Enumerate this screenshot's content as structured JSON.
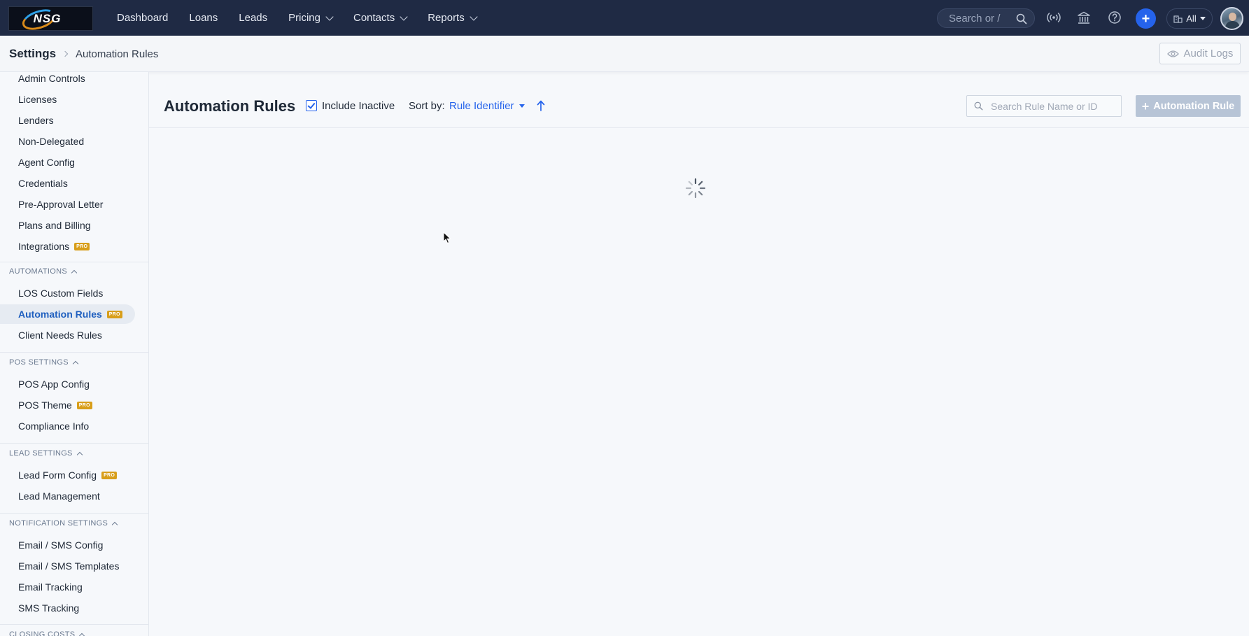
{
  "topbar": {
    "logo_text": "NSG",
    "nav": [
      {
        "label": "Dashboard",
        "has_menu": false
      },
      {
        "label": "Loans",
        "has_menu": false
      },
      {
        "label": "Leads",
        "has_menu": false
      },
      {
        "label": "Pricing",
        "has_menu": true
      },
      {
        "label": "Contacts",
        "has_menu": true
      },
      {
        "label": "Reports",
        "has_menu": true
      }
    ],
    "search_placeholder": "Search or /",
    "scope_label": "All",
    "colors": {
      "bar": "#1f2a44",
      "accent": "#2563eb"
    }
  },
  "breadcrumb": {
    "root": "Settings",
    "current": "Automation Rules",
    "audit_logs_label": "Audit Logs"
  },
  "sidebar": {
    "top_items": [
      {
        "label": "Admin Controls",
        "pro": false
      },
      {
        "label": "Licenses",
        "pro": false
      },
      {
        "label": "Lenders",
        "pro": false
      },
      {
        "label": "Non-Delegated",
        "pro": false
      },
      {
        "label": "Agent Config",
        "pro": false
      },
      {
        "label": "Credentials",
        "pro": false
      },
      {
        "label": "Pre-Approval Letter",
        "pro": false
      },
      {
        "label": "Plans and Billing",
        "pro": false
      },
      {
        "label": "Integrations",
        "pro": true
      }
    ],
    "sections": [
      {
        "title": "AUTOMATIONS",
        "items": [
          {
            "label": "LOS Custom Fields",
            "pro": false,
            "active": false
          },
          {
            "label": "Automation Rules",
            "pro": true,
            "active": true
          },
          {
            "label": "Client Needs Rules",
            "pro": false,
            "active": false
          }
        ]
      },
      {
        "title": "POS SETTINGS",
        "items": [
          {
            "label": "POS App Config",
            "pro": false
          },
          {
            "label": "POS Theme",
            "pro": true
          },
          {
            "label": "Compliance Info",
            "pro": false
          }
        ]
      },
      {
        "title": "LEAD SETTINGS",
        "items": [
          {
            "label": "Lead Form Config",
            "pro": true
          },
          {
            "label": "Lead Management",
            "pro": false
          }
        ]
      },
      {
        "title": "NOTIFICATION SETTINGS",
        "items": [
          {
            "label": "Email / SMS Config",
            "pro": false
          },
          {
            "label": "Email / SMS Templates",
            "pro": false
          },
          {
            "label": "Email Tracking",
            "pro": false
          },
          {
            "label": "SMS Tracking",
            "pro": false
          }
        ]
      },
      {
        "title": "CLOSING COSTS",
        "items": []
      }
    ],
    "pro_badge": "PRO"
  },
  "main": {
    "title": "Automation Rules",
    "include_inactive_label": "Include Inactive",
    "include_inactive_checked": true,
    "sort_label": "Sort by:",
    "sort_value": "Rule Identifier",
    "sort_direction": "ascending",
    "search_placeholder": "Search Rule Name or ID",
    "add_button_label": "Automation Rule",
    "loading": true
  }
}
